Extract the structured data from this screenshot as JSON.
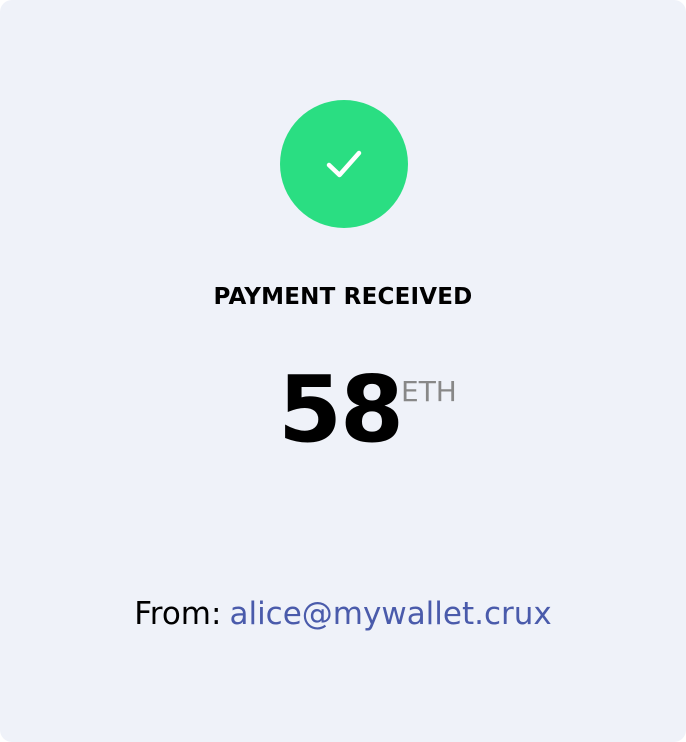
{
  "status": {
    "title": "PAYMENT RECEIVED",
    "icon": "check-icon",
    "icon_bg_color": "#2ade82"
  },
  "amount": {
    "value": "58",
    "currency": "ETH"
  },
  "sender": {
    "label": "From:",
    "address": "alice@mywallet.crux",
    "address_color": "#4a5bab"
  },
  "colors": {
    "card_background": "#eff2f9"
  }
}
